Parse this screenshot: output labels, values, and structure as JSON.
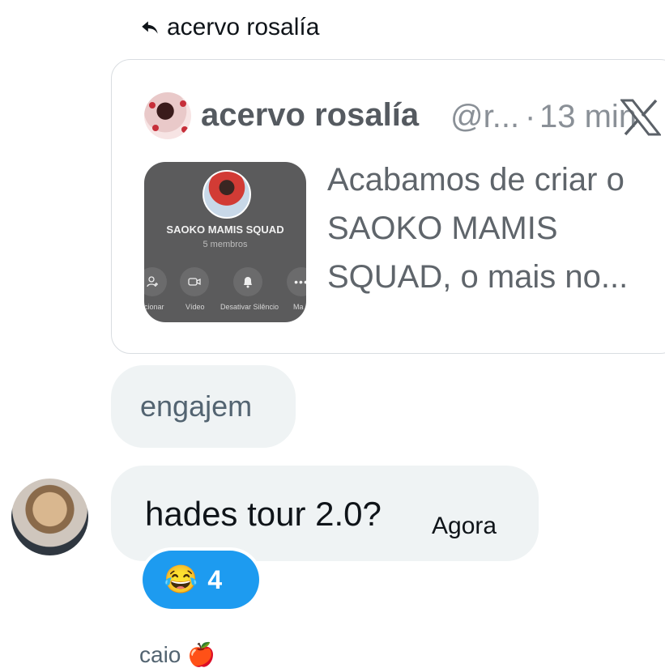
{
  "reply_context": {
    "label": "acervo rosalía"
  },
  "quoted_post": {
    "display_name": "acervo rosalía",
    "handle": "@r...",
    "separator": "·",
    "time": "13 min",
    "text": "Acabamos de criar o SAOKO MAMIS SQUAD, o mais no...",
    "thumbnail": {
      "group_name": "SAOKO MAMIS SQUAD",
      "members": "5 membros",
      "actions": [
        {
          "label": "icionar",
          "icon": "add-person-icon"
        },
        {
          "label": "Vídeo",
          "icon": "video-icon"
        },
        {
          "label": "Desativar Silêncio",
          "icon": "bell-icon"
        },
        {
          "label": "Ma",
          "icon": "more-icon"
        }
      ]
    }
  },
  "messages": [
    {
      "text": "engajem"
    },
    {
      "text": "hades tour 2.0?",
      "timestamp": "Agora"
    }
  ],
  "reaction": {
    "emoji": "😂",
    "count": "4",
    "color": "#1d9bf0"
  },
  "footer_sender": "caio 🍎"
}
